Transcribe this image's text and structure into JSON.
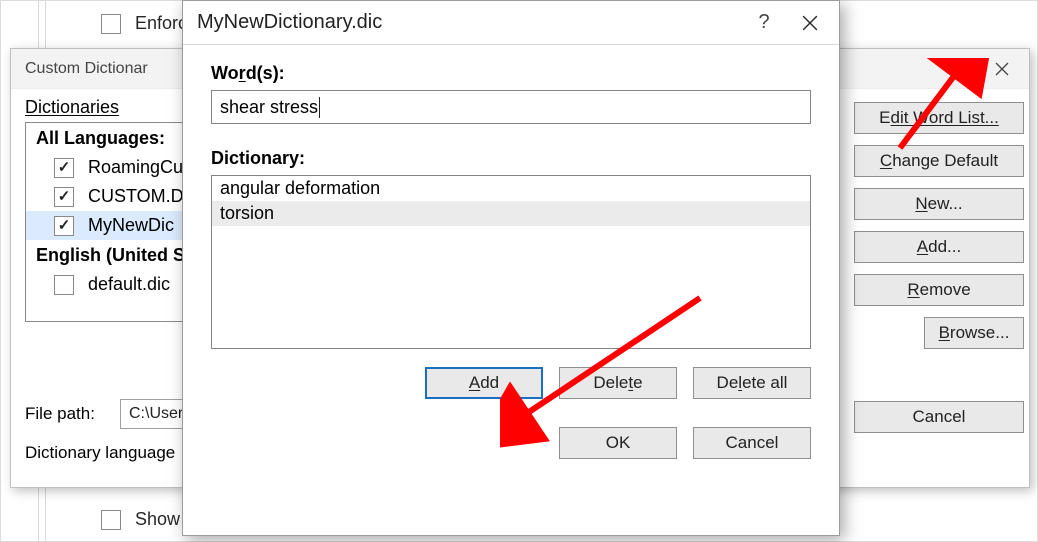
{
  "base": {
    "enforce_label": "Enforc",
    "show_label": "Show"
  },
  "custom_dialog": {
    "title": "Custom Dictionar",
    "dict_label": "Dictionaries",
    "groups": {
      "all_lang": "All Languages:",
      "english_us": "English (United St",
      "items_all": [
        "RoamingCu",
        "CUSTOM.D",
        "MyNewDic"
      ],
      "items_en": [
        "default.dic"
      ]
    },
    "file_path_label": "File path:",
    "file_path_value": "C:\\Users",
    "dict_lang_label": "Dictionary language",
    "buttons": {
      "edit": "dit Word List...",
      "change": "hange Default",
      "new": "ew...",
      "add": "dd...",
      "remove": "emove",
      "browse": "rowse...",
      "cancel": "Cancel"
    }
  },
  "top_dialog": {
    "title": "MyNewDictionary.dic",
    "word_label_pre": "Wo",
    "word_label_u": "r",
    "word_label_post": "d(s):",
    "word_value": "shear stress",
    "dict_label": "Dictionary:",
    "entries": [
      "angular deformation",
      "torsion"
    ],
    "buttons": {
      "add_pre": "",
      "add_u": "A",
      "add_post": "dd",
      "delete_pre": "Dele",
      "delete_u": "t",
      "delete_post": "e",
      "deleteall_pre": "De",
      "deleteall_u": "l",
      "deleteall_post": "ete all",
      "ok": "OK",
      "cancel": "Cancel"
    }
  }
}
